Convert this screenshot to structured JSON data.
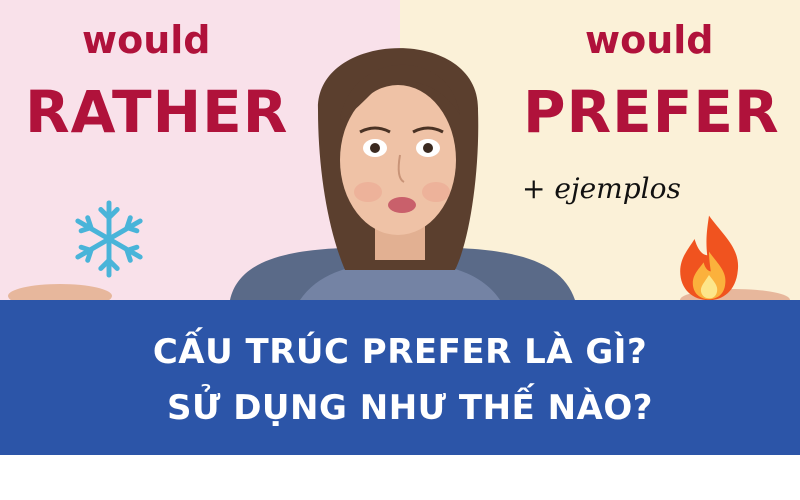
{
  "left_panel": {
    "top_word": "would",
    "main_word": "RATHER"
  },
  "right_panel": {
    "top_word": "would",
    "main_word": "PREFER",
    "extra_text": "+ ejemplos"
  },
  "banner": {
    "line1": "CẤU TRÚC PREFER LÀ GÌ?",
    "line2": "SỬ DỤNG NHƯ THẾ NÀO?"
  },
  "icons": {
    "left": "snowflake-icon",
    "right": "flame-icon"
  },
  "colors": {
    "left_bg": "#f9e1ea",
    "right_bg": "#fbf1d8",
    "title_red": "#b0123b",
    "banner_blue": "#2c55a8"
  }
}
